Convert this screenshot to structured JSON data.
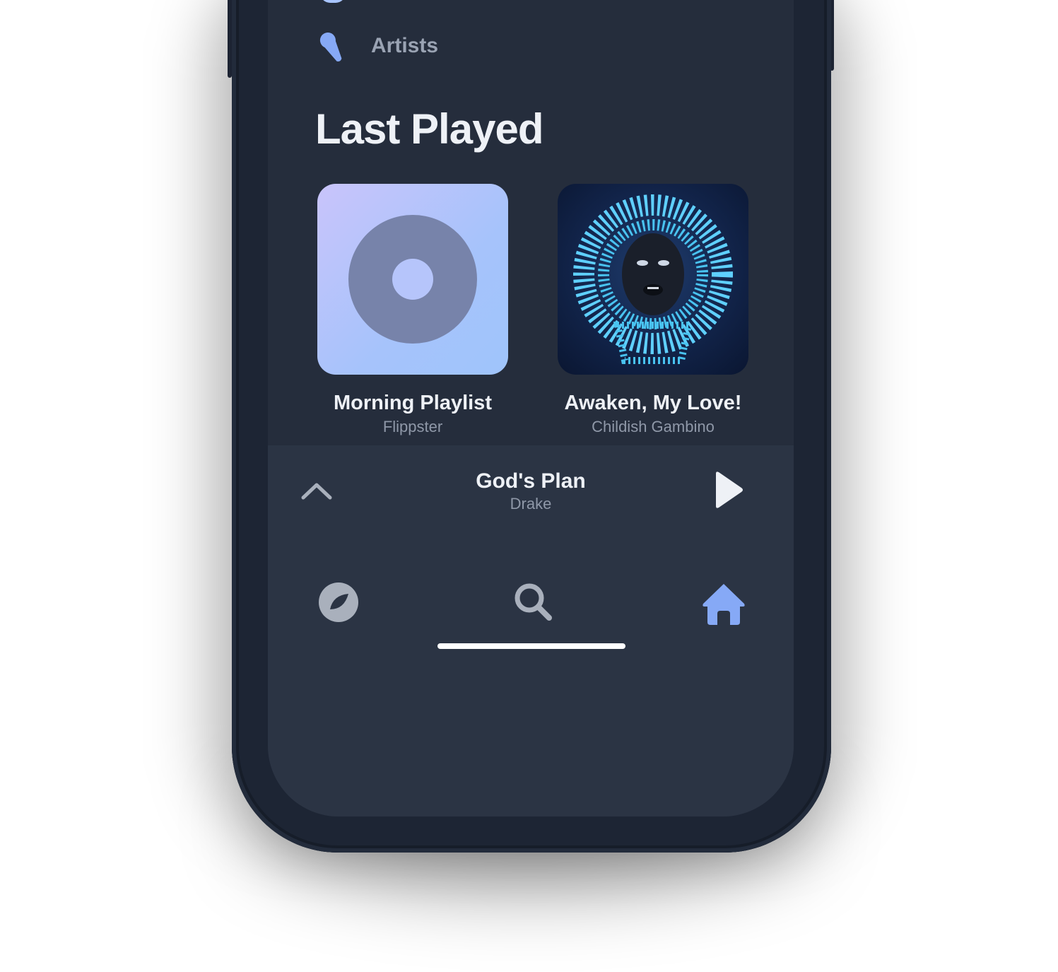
{
  "nav": {
    "artists_label": "Artists",
    "artists_icon": "microphone-icon"
  },
  "section": {
    "title": "Last Played"
  },
  "cards": [
    {
      "title": "Morning Playlist",
      "subtitle": "Flippster",
      "cover": "playlist-disc"
    },
    {
      "title": "Awaken, My Love!",
      "subtitle": "Childish Gambino",
      "cover": "album-art"
    },
    {
      "title": "",
      "subtitle": "",
      "cover": "album-art"
    },
    {
      "title": "",
      "subtitle": "",
      "cover": "album-art"
    }
  ],
  "now_playing": {
    "song": "God's Plan",
    "artist": "Drake",
    "expand_icon": "chevron-up-icon",
    "play_icon": "play-icon"
  },
  "tabs": [
    {
      "name": "browse",
      "icon": "disc-icon",
      "active": false
    },
    {
      "name": "search",
      "icon": "search-icon",
      "active": false
    },
    {
      "name": "home",
      "icon": "home-icon",
      "active": true
    }
  ],
  "colors": {
    "screen_bg": "#252d3c",
    "player_bg": "#2b3444",
    "accent": "#86a9f6",
    "inactive_icon": "#a9b0bc",
    "title_text": "#eef1f6",
    "secondary_text": "#8f98a8"
  }
}
